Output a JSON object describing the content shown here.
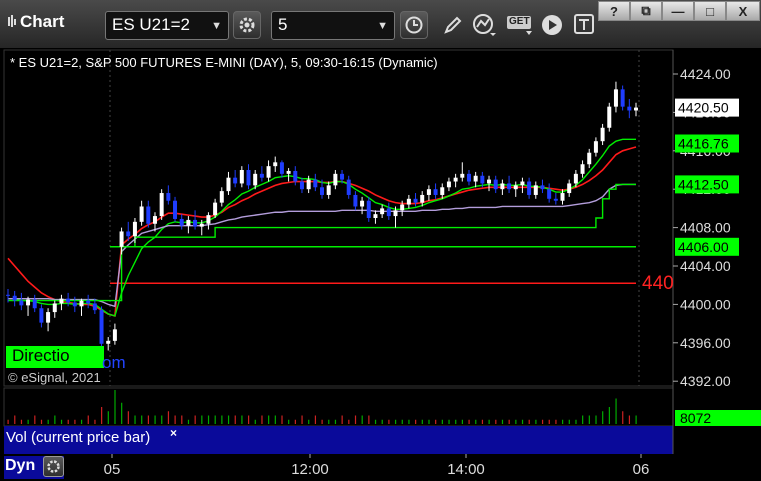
{
  "app": {
    "title": "Chart"
  },
  "toolbar": {
    "symbol": "ES U21=2",
    "interval": "5",
    "get_label": "GET"
  },
  "window_buttons": {
    "help": "?",
    "restore": "⧉",
    "minimize": "—",
    "maximize": "□",
    "close": "X"
  },
  "chart": {
    "legend": "* ES U21=2, S&P 500 FUTURES E-MINI (DAY), 5, 09:30-16:15 (Dynamic)",
    "copyright": "© eSignal, 2021",
    "direction_label": "Directio",
    "direction_tail": "om",
    "price_label_clipped": "440",
    "y_ticks": [
      "4424.00",
      "4420.00",
      "4416.00",
      "4412.00",
      "4408.00",
      "4404.00",
      "4400.00",
      "4396.00",
      "4392.00"
    ],
    "x_ticks": [
      "05",
      "12:00",
      "14:00",
      "06"
    ],
    "price_tags": [
      {
        "label": "4420.50",
        "style": "current"
      },
      {
        "label": "4416.76",
        "style": "green"
      },
      {
        "label": "4412.50",
        "style": "green"
      },
      {
        "label": "4406.00",
        "style": "green"
      }
    ],
    "volume_tag": "8072",
    "volume_label": "Vol (current price bar)",
    "volume_close": "×",
    "dyn_label": "Dyn"
  },
  "colors": {
    "up_candle": "#ffffff",
    "down_candle": "#1f3dff",
    "red_line": "#ff1a1a",
    "green_line": "#00ee00",
    "purple_line": "#b39ddb",
    "tag_green": "#00ff00",
    "panel_blue": "#0a0a9a"
  },
  "chart_data": {
    "type": "candlestick",
    "y_unit": "price",
    "ylim": [
      4391.5,
      4426.5
    ],
    "x_ticks": [
      "05",
      "12:00",
      "14:00",
      "06"
    ],
    "candles_ohlc": [
      [
        4401.0,
        4401.6,
        4400.2,
        4400.9
      ],
      [
        4400.9,
        4401.4,
        4399.8,
        4400.4
      ],
      [
        4400.4,
        4401.2,
        4399.4,
        4399.9
      ],
      [
        4399.9,
        4400.8,
        4398.8,
        4400.5
      ],
      [
        4400.5,
        4401.0,
        4399.2,
        4399.6
      ],
      [
        4399.6,
        4400.0,
        4397.6,
        4398.1
      ],
      [
        4398.1,
        4399.6,
        4397.2,
        4399.2
      ],
      [
        4399.2,
        4400.4,
        4398.6,
        4400.1
      ],
      [
        4400.1,
        4401.0,
        4399.4,
        4400.6
      ],
      [
        4400.6,
        4401.2,
        4399.8,
        4400.2
      ],
      [
        4400.2,
        4400.8,
        4399.2,
        4399.8
      ],
      [
        4399.8,
        4400.6,
        4398.8,
        4400.4
      ],
      [
        4400.4,
        4401.0,
        4399.6,
        4400.1
      ],
      [
        4400.1,
        4400.6,
        4399.0,
        4399.4
      ],
      [
        4399.4,
        4399.8,
        4395.2,
        4395.9
      ],
      [
        4395.9,
        4396.6,
        4395.2,
        4396.2
      ],
      [
        4396.2,
        4398.0,
        4395.8,
        4397.4
      ],
      [
        4406.0,
        4408.0,
        4405.2,
        4407.6
      ],
      [
        4407.6,
        4408.6,
        4406.6,
        4407.1
      ],
      [
        4407.1,
        4409.0,
        4406.4,
        4408.6
      ],
      [
        4408.6,
        4410.8,
        4408.2,
        4410.2
      ],
      [
        4410.2,
        4410.8,
        4408.0,
        4408.4
      ],
      [
        4408.4,
        4409.6,
        4407.6,
        4409.2
      ],
      [
        4409.2,
        4412.0,
        4408.8,
        4411.6
      ],
      [
        4411.6,
        4412.4,
        4410.4,
        4410.8
      ],
      [
        4410.8,
        4411.2,
        4408.6,
        4408.9
      ],
      [
        4408.9,
        4409.4,
        4407.8,
        4408.2
      ],
      [
        4408.2,
        4409.2,
        4407.4,
        4408.8
      ],
      [
        4408.8,
        4409.8,
        4407.8,
        4408.1
      ],
      [
        4408.1,
        4408.8,
        4407.2,
        4408.4
      ],
      [
        4408.4,
        4409.6,
        4407.8,
        4409.3
      ],
      [
        4409.3,
        4411.0,
        4409.0,
        4410.6
      ],
      [
        4410.6,
        4412.2,
        4410.2,
        4411.8
      ],
      [
        4411.8,
        4413.8,
        4411.4,
        4413.2
      ],
      [
        4413.2,
        4414.0,
        4412.2,
        4412.6
      ],
      [
        4412.6,
        4414.4,
        4412.2,
        4414.0
      ],
      [
        4414.0,
        4414.6,
        4412.0,
        4412.4
      ],
      [
        4412.4,
        4414.0,
        4412.0,
        4413.6
      ],
      [
        4413.6,
        4414.4,
        4412.8,
        4413.2
      ],
      [
        4413.2,
        4415.0,
        4412.8,
        4414.4
      ],
      [
        4414.4,
        4415.4,
        4413.8,
        4414.8
      ],
      [
        4414.8,
        4415.0,
        4413.2,
        4413.6
      ],
      [
        4413.6,
        4414.2,
        4412.8,
        4413.9
      ],
      [
        4413.9,
        4414.4,
        4412.4,
        4412.8
      ],
      [
        4412.8,
        4413.2,
        4411.6,
        4412.0
      ],
      [
        4412.0,
        4413.4,
        4411.6,
        4413.0
      ],
      [
        4413.0,
        4413.6,
        4411.8,
        4412.2
      ],
      [
        4412.2,
        4413.0,
        4411.0,
        4411.4
      ],
      [
        4411.4,
        4412.8,
        4411.0,
        4412.4
      ],
      [
        4412.4,
        4414.0,
        4412.0,
        4413.6
      ],
      [
        4413.6,
        4414.0,
        4412.6,
        4413.0
      ],
      [
        4413.0,
        4413.4,
        4411.0,
        4411.4
      ],
      [
        4411.4,
        4411.8,
        4409.8,
        4410.2
      ],
      [
        4410.2,
        4411.2,
        4409.4,
        4410.8
      ],
      [
        4410.8,
        4411.2,
        4408.6,
        4409.0
      ],
      [
        4409.0,
        4409.8,
        4408.4,
        4409.4
      ],
      [
        4409.4,
        4410.4,
        4409.0,
        4410.0
      ],
      [
        4410.0,
        4410.6,
        4408.8,
        4409.2
      ],
      [
        4409.2,
        4410.2,
        4408.0,
        4409.8
      ],
      [
        4409.8,
        4410.8,
        4409.2,
        4410.4
      ],
      [
        4410.4,
        4411.4,
        4410.0,
        4411.0
      ],
      [
        4411.0,
        4411.6,
        4410.2,
        4410.6
      ],
      [
        4410.6,
        4411.8,
        4410.2,
        4411.4
      ],
      [
        4411.4,
        4412.4,
        4410.8,
        4412.0
      ],
      [
        4412.0,
        4412.6,
        4411.0,
        4411.4
      ],
      [
        4411.4,
        4412.6,
        4411.0,
        4412.2
      ],
      [
        4412.2,
        4413.2,
        4411.8,
        4412.8
      ],
      [
        4412.8,
        4413.6,
        4412.2,
        4413.2
      ],
      [
        4413.2,
        4414.8,
        4412.8,
        4413.6
      ],
      [
        4413.6,
        4414.0,
        4412.4,
        4412.8
      ],
      [
        4412.8,
        4413.8,
        4412.2,
        4413.4
      ],
      [
        4413.4,
        4413.8,
        4412.2,
        4412.6
      ],
      [
        4412.6,
        4413.4,
        4411.8,
        4413.0
      ],
      [
        4413.0,
        4413.4,
        4411.6,
        4412.0
      ],
      [
        4412.0,
        4413.0,
        4411.4,
        4412.6
      ],
      [
        4412.6,
        4413.4,
        4411.6,
        4412.0
      ],
      [
        4412.0,
        4412.8,
        4411.2,
        4412.4
      ],
      [
        4412.4,
        4413.2,
        4411.6,
        4412.8
      ],
      [
        4412.8,
        4413.2,
        4411.0,
        4411.4
      ],
      [
        4411.4,
        4412.8,
        4411.0,
        4412.4
      ],
      [
        4412.4,
        4413.0,
        4411.6,
        4412.0
      ],
      [
        4412.0,
        4412.6,
        4410.6,
        4411.0
      ],
      [
        4411.0,
        4411.6,
        4410.4,
        4410.8
      ],
      [
        4410.8,
        4412.0,
        4410.4,
        4411.6
      ],
      [
        4411.6,
        4413.0,
        4411.2,
        4412.6
      ],
      [
        4412.6,
        4414.0,
        4412.2,
        4413.6
      ],
      [
        4413.6,
        4415.0,
        4413.2,
        4414.6
      ],
      [
        4414.6,
        4416.2,
        4414.2,
        4415.8
      ],
      [
        4415.8,
        4417.4,
        4415.4,
        4417.0
      ],
      [
        4417.0,
        4418.8,
        4416.6,
        4418.4
      ],
      [
        4418.4,
        4421.0,
        4418.0,
        4420.6
      ],
      [
        4420.6,
        4423.2,
        4420.0,
        4422.4
      ],
      [
        4422.4,
        4422.8,
        4420.2,
        4420.6
      ],
      [
        4420.6,
        4421.4,
        4419.4,
        4420.2
      ],
      [
        4420.2,
        4421.0,
        4419.6,
        4420.5
      ]
    ],
    "series": [
      {
        "type": "line",
        "values": [
          4404.8,
          4404.0,
          4403.2,
          4402.4,
          4401.8,
          4401.2,
          4400.8,
          4400.5,
          4400.3,
          4400.2,
          4400.1,
          4400.0,
          4400.0,
          4399.8,
          4399.4,
          4399.0,
          4398.8,
          4406.2,
          4406.8,
          4407.3,
          4407.9,
          4408.3,
          4408.6,
          4409.1,
          4409.5,
          4409.5,
          4409.4,
          4409.3,
          4409.2,
          4409.1,
          4409.1,
          4409.3,
          4409.6,
          4410.1,
          4410.4,
          4410.8,
          4411.1,
          4411.5,
          4411.8,
          4412.1,
          4412.4,
          4412.6,
          4412.7,
          4412.8,
          4412.8,
          4412.8,
          4412.8,
          4412.7,
          4412.7,
          4412.8,
          4412.8,
          4412.6,
          4412.4,
          4412.1,
          4411.8,
          4411.4,
          4411.1,
          4410.8,
          4410.6,
          4410.5,
          4410.5,
          4410.5,
          4410.6,
          4410.8,
          4410.9,
          4411.1,
          4411.3,
          4411.5,
          4411.7,
          4411.9,
          4412.0,
          4412.1,
          4412.2,
          4412.2,
          4412.2,
          4412.2,
          4412.2,
          4412.2,
          4412.2,
          4412.2,
          4412.2,
          4412.1,
          4412.0,
          4411.9,
          4412.0,
          4412.2,
          4412.5,
          4412.9,
          4413.4,
          4414.0,
          4414.8,
          4415.6,
          4416.0,
          4416.2,
          4416.4
        ]
      },
      {
        "type": "line",
        "values": [
          4400.6,
          4400.6,
          4400.4,
          4400.4,
          4400.3,
          4400.1,
          4400.0,
          4400.0,
          4400.1,
          4400.1,
          4400.0,
          4400.1,
          4400.1,
          4400.0,
          4399.5,
          4399.0,
          4398.8,
          4401.2,
          4403.0,
          4404.4,
          4405.8,
          4406.5,
          4407.0,
          4407.8,
          4408.4,
          4408.6,
          4408.5,
          4408.6,
          4408.5,
          4408.5,
          4408.7,
          4409.1,
          4409.7,
          4410.4,
          4410.9,
          4411.5,
          4411.8,
          4412.2,
          4412.5,
          4412.8,
          4413.2,
          4413.3,
          4413.4,
          4413.3,
          4413.1,
          4413.1,
          4413.0,
          4412.7,
          4412.6,
          4412.8,
          4412.8,
          4412.5,
          4412.0,
          4411.6,
          4411.1,
          4410.6,
          4410.4,
          4410.1,
          4409.9,
          4409.9,
          4410.0,
          4410.1,
          4410.3,
          4410.6,
          4410.8,
          4411.0,
          4411.3,
          4411.6,
          4412.0,
          4412.1,
          4412.3,
          4412.4,
          4412.5,
          4412.4,
          4412.5,
          4412.4,
          4412.4,
          4412.5,
          4412.3,
          4412.3,
          4412.2,
          4412.0,
          4411.7,
          4411.7,
          4412.0,
          4412.4,
          4413.0,
          4413.8,
          4414.6,
          4415.5,
          4416.5,
          4417.0,
          4417.2,
          4417.2,
          4417.2
        ]
      },
      {
        "type": "line",
        "values": [
          4400.6,
          4400.6,
          4400.6,
          4400.6,
          4400.6,
          4400.6,
          4400.6,
          4400.5,
          4400.5,
          4400.5,
          4400.5,
          4400.5,
          4400.5,
          4400.5,
          4400.3,
          4400.0,
          4399.8,
          4405.5,
          4406.2,
          4406.8,
          4407.4,
          4407.6,
          4407.8,
          4408.0,
          4408.2,
          4408.2,
          4408.2,
          4408.2,
          4408.2,
          4408.2,
          4408.3,
          4408.4,
          4408.6,
          4408.8,
          4408.9,
          4409.1,
          4409.2,
          4409.3,
          4409.4,
          4409.5,
          4409.6,
          4409.6,
          4409.7,
          4409.7,
          4409.7,
          4409.7,
          4409.7,
          4409.7,
          4409.7,
          4409.7,
          4409.8,
          4409.8,
          4409.8,
          4409.8,
          4409.8,
          4409.7,
          4409.7,
          4409.7,
          4409.7,
          4409.7,
          4409.7,
          4409.7,
          4409.8,
          4409.8,
          4409.8,
          4409.9,
          4409.9,
          4410.0,
          4410.0,
          4410.1,
          4410.1,
          4410.1,
          4410.1,
          4410.1,
          4410.2,
          4410.2,
          4410.2,
          4410.2,
          4410.2,
          4410.2,
          4410.2,
          4410.2,
          4410.2,
          4410.2,
          4410.3,
          4410.4,
          4410.5,
          4410.6,
          4410.8,
          4411.2,
          4412.0,
          4412.4,
          4412.5,
          4412.5,
          4412.5
        ]
      },
      {
        "type": "step",
        "values": [
          4400.4,
          4400.4,
          4400.4,
          4400.4,
          4400.4,
          4400.4,
          4400.4,
          4400.4,
          4400.4,
          4400.4,
          4400.4,
          4400.4,
          4400.4,
          4400.4,
          4400.4,
          4400.4,
          4400.4,
          4406.0,
          4406.0,
          4407.0,
          4407.0,
          4407.0,
          4407.0,
          4407.0,
          4407.0,
          4407.0,
          4407.0,
          4407.0,
          4407.0,
          4407.0,
          4407.0,
          4408.0,
          4408.0,
          4408.0,
          4408.0,
          4408.0,
          4408.0,
          4408.0,
          4408.0,
          4408.0,
          4408.0,
          4408.0,
          4408.0,
          4408.0,
          4408.0,
          4408.0,
          4408.0,
          4408.0,
          4408.0,
          4408.0,
          4408.0,
          4408.0,
          4408.0,
          4408.0,
          4408.0,
          4408.0,
          4408.0,
          4408.0,
          4408.0,
          4408.0,
          4408.0,
          4408.0,
          4408.0,
          4408.0,
          4408.0,
          4408.0,
          4408.0,
          4408.0,
          4408.0,
          4408.0,
          4408.0,
          4408.0,
          4408.0,
          4408.0,
          4408.0,
          4408.0,
          4408.0,
          4408.0,
          4408.0,
          4408.0,
          4408.0,
          4408.0,
          4408.0,
          4408.0,
          4408.0,
          4408.0,
          4408.0,
          4408.0,
          4409.0,
          4411.0,
          4412.0,
          4412.5,
          4412.5,
          4412.5,
          4412.5
        ]
      }
    ],
    "horizontal_lines": [
      {
        "y": 4406.0,
        "color": "green"
      },
      {
        "y": 4402.2,
        "color": "red"
      }
    ],
    "volume": [
      1,
      2,
      1,
      1,
      2,
      1,
      1,
      2,
      1,
      1,
      1,
      1,
      2,
      1,
      4,
      3,
      8,
      5,
      3,
      2,
      2,
      2,
      2,
      2,
      3,
      2,
      2,
      1,
      2,
      2,
      2,
      2,
      2,
      2,
      2,
      2,
      2,
      1,
      2,
      2,
      2,
      2,
      1,
      1,
      2,
      1,
      2,
      1,
      1,
      1,
      2,
      1,
      2,
      2,
      2,
      1,
      1,
      1,
      1,
      1,
      1,
      1,
      1,
      1,
      1,
      1,
      1,
      1,
      1,
      1,
      1,
      1,
      1,
      1,
      1,
      1,
      1,
      1,
      1,
      1,
      1,
      1,
      1,
      1,
      1,
      1,
      2,
      2,
      2,
      3,
      4,
      6,
      3,
      2,
      2
    ]
  }
}
